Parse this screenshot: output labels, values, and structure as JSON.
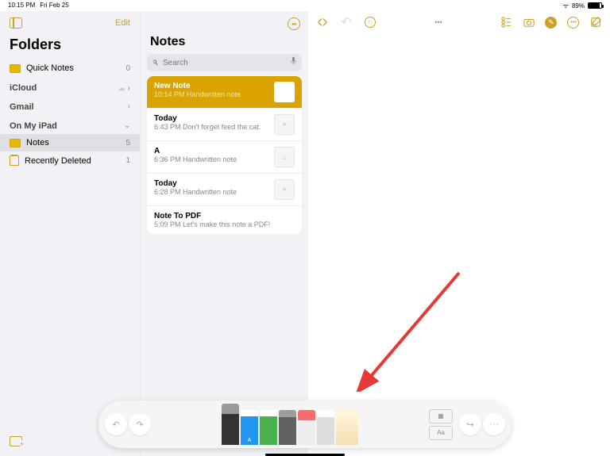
{
  "status": {
    "time": "10:15 PM",
    "date": "Fri Feb 25",
    "battery": "89%"
  },
  "sidebar": {
    "edit": "Edit",
    "title": "Folders",
    "quick": {
      "name": "Quick Notes",
      "count": "0"
    },
    "accounts": [
      {
        "name": "iCloud"
      },
      {
        "name": "Gmail"
      },
      {
        "name": "On My iPad",
        "expanded": true,
        "folders": [
          {
            "name": "Notes",
            "count": "5",
            "selected": true
          },
          {
            "name": "Recently Deleted",
            "count": "1"
          }
        ]
      }
    ]
  },
  "list": {
    "title": "Notes",
    "search_ph": "Search",
    "items": [
      {
        "title": "New Note",
        "sub": "10:14 PM  Handwritten note",
        "selected": true
      },
      {
        "title": "Today",
        "sub": "6:43 PM  Don't forget feed the cat.",
        "thumb": "lines"
      },
      {
        "title": "A",
        "sub": "6:36 PM  Handwritten note",
        "thumb": "triangle"
      },
      {
        "title": "Today",
        "sub": "6:28 PM  Handwritten note",
        "thumb": "lines"
      },
      {
        "title": "Note To PDF",
        "sub": "5:09 PM  Let's make this note a PDF!"
      }
    ]
  },
  "drawtools": {
    "undo": "↶",
    "redo": "↷",
    "tools": [
      "pen",
      "marker-blue",
      "marker-green",
      "pencil",
      "eraser",
      "lasso",
      "ruler"
    ],
    "grid": "▦",
    "text": "Aa",
    "send": "↪",
    "more": "···"
  }
}
